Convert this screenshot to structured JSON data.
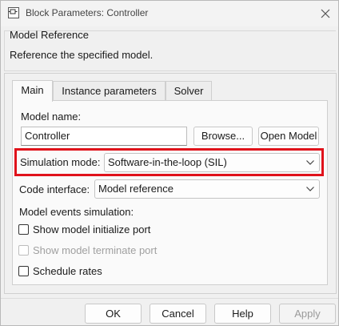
{
  "window": {
    "title": "Block Parameters: Controller"
  },
  "header": {
    "title": "Model Reference",
    "description": "Reference the specified model."
  },
  "tabs": [
    {
      "label": "Main",
      "active": true
    },
    {
      "label": "Instance parameters",
      "active": false
    },
    {
      "label": "Solver",
      "active": false
    }
  ],
  "main": {
    "model_name_label": "Model name:",
    "model_name_value": "Controller",
    "browse_label": "Browse...",
    "open_model_label": "Open Model",
    "simulation_mode_label": "Simulation mode:",
    "simulation_mode_value": "Software-in-the-loop (SIL)",
    "code_interface_label": "Code interface:",
    "code_interface_value": "Model reference",
    "events_label": "Model events simulation:",
    "checkboxes": [
      {
        "label": "Show model initialize port",
        "checked": false,
        "enabled": true
      },
      {
        "label": "Show model terminate port",
        "checked": false,
        "enabled": false
      },
      {
        "label": "Schedule rates",
        "checked": false,
        "enabled": true
      }
    ]
  },
  "footer": {
    "ok": "OK",
    "cancel": "Cancel",
    "help": "Help",
    "apply": "Apply"
  },
  "colors": {
    "highlight": "#e0121b"
  }
}
